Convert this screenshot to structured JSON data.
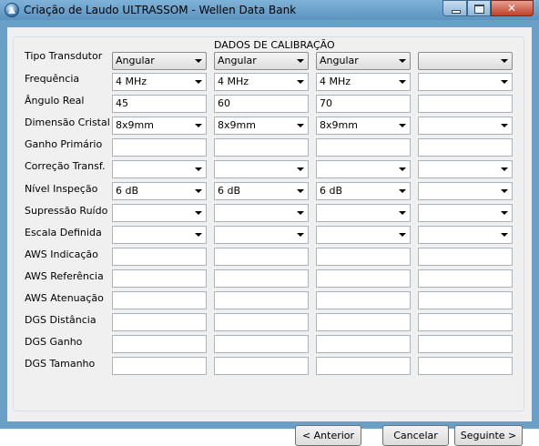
{
  "window": {
    "title": "Criação de Laudo ULTRASSOM - Wellen Data Bank"
  },
  "group": {
    "title": "DADOS DE CALIBRAÇÃO"
  },
  "rows": [
    {
      "label": "Tipo Transdutor",
      "kind": "dropdown",
      "values": [
        "Angular",
        "Angular",
        "Angular",
        ""
      ]
    },
    {
      "label": "Frequência",
      "kind": "combo",
      "values": [
        "4 MHz",
        "4 MHz",
        "4 MHz",
        ""
      ]
    },
    {
      "label": "Ângulo Real",
      "kind": "text",
      "values": [
        "45",
        "60",
        "70",
        ""
      ]
    },
    {
      "label": "Dimensão Cristal",
      "kind": "combo",
      "values": [
        "8x9mm",
        "8x9mm",
        "8x9mm",
        ""
      ]
    },
    {
      "label": "Ganho Primário",
      "kind": "text",
      "values": [
        "",
        "",
        "",
        ""
      ]
    },
    {
      "label": "Correção Transf.",
      "kind": "combo",
      "values": [
        "",
        "",
        "",
        ""
      ]
    },
    {
      "label": "Nível Inspeção",
      "kind": "combo",
      "values": [
        "6 dB",
        "6 dB",
        "6 dB",
        ""
      ]
    },
    {
      "label": "Supressão Ruído",
      "kind": "combo",
      "values": [
        "",
        "",
        "",
        ""
      ]
    },
    {
      "label": "Escala Definida",
      "kind": "combo",
      "values": [
        "",
        "",
        "",
        ""
      ]
    },
    {
      "label": "AWS Indicação",
      "kind": "text",
      "values": [
        "",
        "",
        "",
        ""
      ]
    },
    {
      "label": "AWS Referência",
      "kind": "text",
      "values": [
        "",
        "",
        "",
        ""
      ]
    },
    {
      "label": "AWS Atenuação",
      "kind": "text",
      "values": [
        "",
        "",
        "",
        ""
      ]
    },
    {
      "label": "DGS Distância",
      "kind": "text",
      "values": [
        "",
        "",
        "",
        ""
      ]
    },
    {
      "label": "DGS Ganho",
      "kind": "text",
      "values": [
        "",
        "",
        "",
        ""
      ]
    },
    {
      "label": "DGS Tamanho",
      "kind": "text",
      "values": [
        "",
        "",
        "",
        ""
      ]
    }
  ],
  "buttons": {
    "previous": "< Anterior",
    "cancel": "Cancelar",
    "next": "Seguinte >"
  }
}
